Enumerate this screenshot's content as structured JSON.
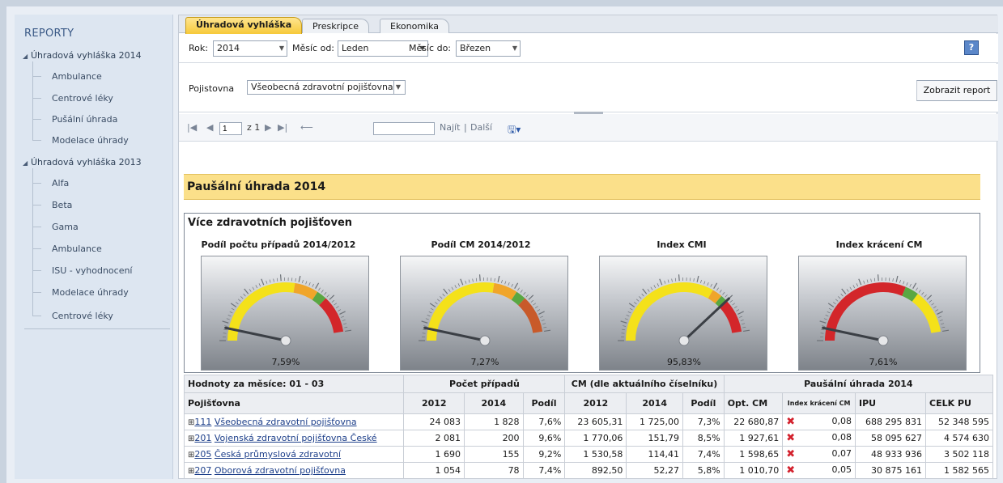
{
  "sidebar": {
    "title": "REPORTY",
    "groups": [
      {
        "label": "Úhradová vyhláška 2014",
        "items": [
          "Ambulance",
          "Centrové léky",
          "Pušální úhrada",
          "Modelace úhrady"
        ]
      },
      {
        "label": "Úhradová vyhláška 2013",
        "items": [
          "Alfa",
          "Beta",
          "Gama",
          "Ambulance",
          "ISU - vyhodnocení",
          "Modelace úhrady",
          "Centrové léky"
        ]
      }
    ]
  },
  "tabs": [
    "Úhradová vyhláška",
    "Preskripce",
    "Ekonomika"
  ],
  "params": {
    "rok_label": "Rok:",
    "rok_value": "2014",
    "mesic_od_label": "Měsíc od:",
    "mesic_od_value": "Leden",
    "mesic_do_label": "Měsíc do:",
    "mesic_do_value": "Březen",
    "help": "?",
    "pojistovna_label": "Pojistovna",
    "pojistovna_value": "Všeobecná zdravotní pojišťovna",
    "report_button": "Zobrazit report"
  },
  "toolbar": {
    "page": "1",
    "of": "z 1",
    "find": "Najít",
    "sep": "|",
    "next": "Další"
  },
  "report": {
    "title": "Paušální úhrada 2014",
    "subtitle": "Více zdravotních pojišťoven"
  },
  "gauges": [
    {
      "title": "Podíl počtu případů 2014/2012",
      "value": "7,59%",
      "fraction": 0.07
    },
    {
      "title": "Podíl CM 2014/2012",
      "value": "7,27%",
      "fraction": 0.07
    },
    {
      "title": "Index CMI",
      "value": "95,83%",
      "fraction": 0.8
    },
    {
      "title": "Index krácení CM",
      "value": "7,61%",
      "fraction": 0.07
    }
  ],
  "table": {
    "group_headers": [
      "Hodnoty za měsíce: 01 - 03",
      "Počet případů",
      "CM (dle aktuálního číselníku)",
      "Paušální úhrada 2014"
    ],
    "columns": [
      "Pojišťovna",
      "2012",
      "2014",
      "Podíl",
      "2012",
      "2014",
      "Podíl",
      "Opt. CM",
      "Index krácení CM",
      "IPU",
      "CELK PU"
    ],
    "rows": [
      {
        "code": "111",
        "name": "Všeobecná zdravotní pojišťovna",
        "c1": "24 083",
        "c2": "1 828",
        "c3": "7,6%",
        "c4": "23 605,31",
        "c5": "1 725,00",
        "c6": "7,3%",
        "c7": "22 680,87",
        "c8": "0,08",
        "c9": "688 295 831",
        "c10": "52 348 595"
      },
      {
        "code": "201",
        "name": "Vojenská zdravotní pojišťovna České",
        "c1": "2 081",
        "c2": "200",
        "c3": "9,6%",
        "c4": "1 770,06",
        "c5": "151,79",
        "c6": "8,5%",
        "c7": "1 927,61",
        "c8": "0,08",
        "c9": "58 095 627",
        "c10": "4 574 630"
      },
      {
        "code": "205",
        "name": "Česká průmyslová zdravotní",
        "c1": "1 690",
        "c2": "155",
        "c3": "9,2%",
        "c4": "1 530,58",
        "c5": "114,41",
        "c6": "7,4%",
        "c7": "1 598,65",
        "c8": "0,07",
        "c9": "48 933 936",
        "c10": "3 502 118"
      },
      {
        "code": "207",
        "name": "Oborová zdravotní pojišťovna",
        "c1": "1 054",
        "c2": "78",
        "c3": "7,4%",
        "c4": "892,50",
        "c5": "52,27",
        "c6": "5,8%",
        "c7": "1 010,70",
        "c8": "0,05",
        "c9": "30 875 161",
        "c10": "1 582 565"
      }
    ]
  }
}
